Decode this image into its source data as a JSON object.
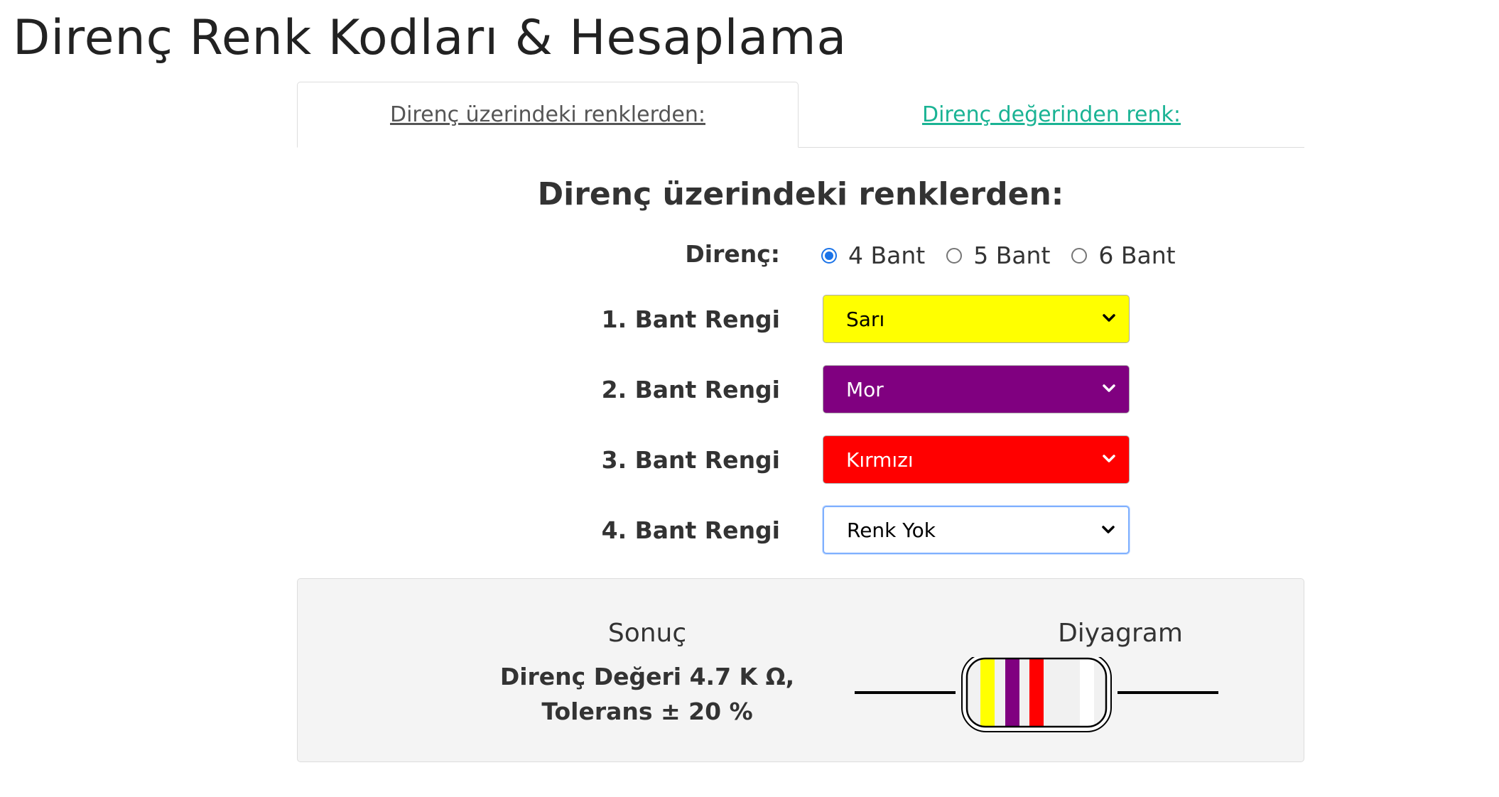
{
  "page": {
    "title": "Direnç Renk Kodları & Hesaplama"
  },
  "tabs": [
    {
      "label": "Direnç üzerindeki renklerden:",
      "active": true
    },
    {
      "label": "Direnç değerinden renk:",
      "active": false
    }
  ],
  "form": {
    "section_title": "Direnç üzerindeki renklerden:",
    "resistor_label": "Direnç:",
    "band_options": [
      {
        "label": "4 Bant",
        "checked": true
      },
      {
        "label": "5 Bant",
        "checked": false
      },
      {
        "label": "6 Bant",
        "checked": false
      }
    ],
    "bands": [
      {
        "label": "1. Bant Rengi",
        "value": "Sarı",
        "bg": "#ffff00",
        "fg": "#000000"
      },
      {
        "label": "2. Bant Rengi",
        "value": "Mor",
        "bg": "#800080",
        "fg": "#ffffff"
      },
      {
        "label": "3. Bant Rengi",
        "value": "Kırmızı",
        "bg": "#ff0000",
        "fg": "#ffffff"
      },
      {
        "label": "4. Bant Rengi",
        "value": "Renk Yok",
        "bg": "#ffffff",
        "fg": "#000000"
      }
    ]
  },
  "result": {
    "title": "Sonuç",
    "value_line": "Direnç Değeri 4.7 K Ω,",
    "tolerance_line": "Tolerans ± 20 %"
  },
  "diagram": {
    "title": "Diyagram",
    "band_colors": [
      "#ffff00",
      "#800080",
      "#ff0000",
      "#ffffff"
    ]
  },
  "colors": {
    "accent": "#1ab394",
    "radio": "#1a73e8"
  }
}
